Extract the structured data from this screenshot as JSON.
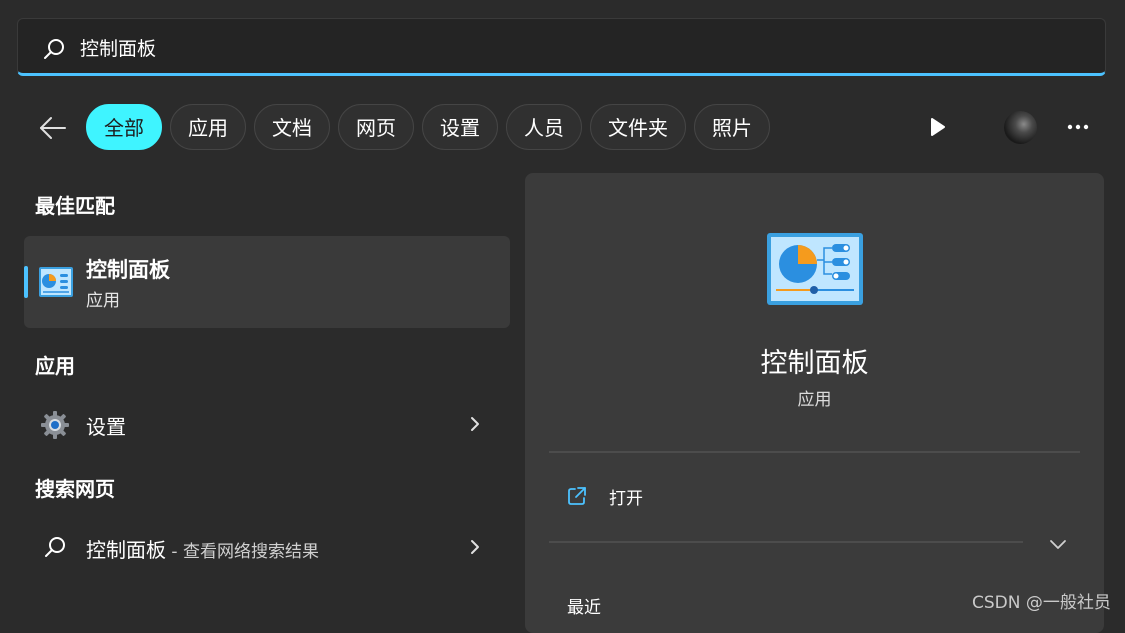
{
  "search": {
    "value": "控制面板",
    "placeholder": ""
  },
  "filters": [
    "全部",
    "应用",
    "文档",
    "网页",
    "设置",
    "人员",
    "文件夹",
    "照片"
  ],
  "active_filter": "全部",
  "best_match": {
    "heading": "最佳匹配",
    "title": "控制面板",
    "subtitle": "应用"
  },
  "apps": {
    "heading": "应用",
    "items": [
      {
        "label": "设置",
        "icon": "settings-gear-icon"
      }
    ]
  },
  "web": {
    "heading": "搜索网页",
    "items": [
      {
        "label": "控制面板",
        "suffix": " - 查看网络搜索结果",
        "icon": "search-icon"
      }
    ]
  },
  "preview": {
    "title": "控制面板",
    "subtitle": "应用",
    "actions": [
      {
        "label": "打开",
        "icon": "open-external-icon"
      }
    ],
    "recent_heading": "最近"
  },
  "watermark": "CSDN @一般社员",
  "colors": {
    "accent": "#4cc2ff",
    "active_chip": "#3ff4ff",
    "background": "#2b2b2b",
    "panel": "#3b3b3b"
  }
}
